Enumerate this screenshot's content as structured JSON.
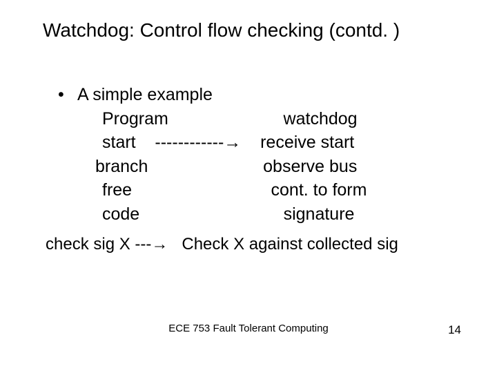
{
  "title": "Watchdog: Control flow checking (contd. )",
  "bullet": "A simple example",
  "lines": {
    "l1": "Program                        watchdog",
    "l2": "start    ------------→    receive start",
    "l3": "branch                        observe bus",
    "l4": "free                             cont. to form",
    "l5": "code                              signature"
  },
  "check_line": "check sig X ---→   Check X against collected sig",
  "footer": "ECE 753 Fault Tolerant Computing",
  "page": "14"
}
